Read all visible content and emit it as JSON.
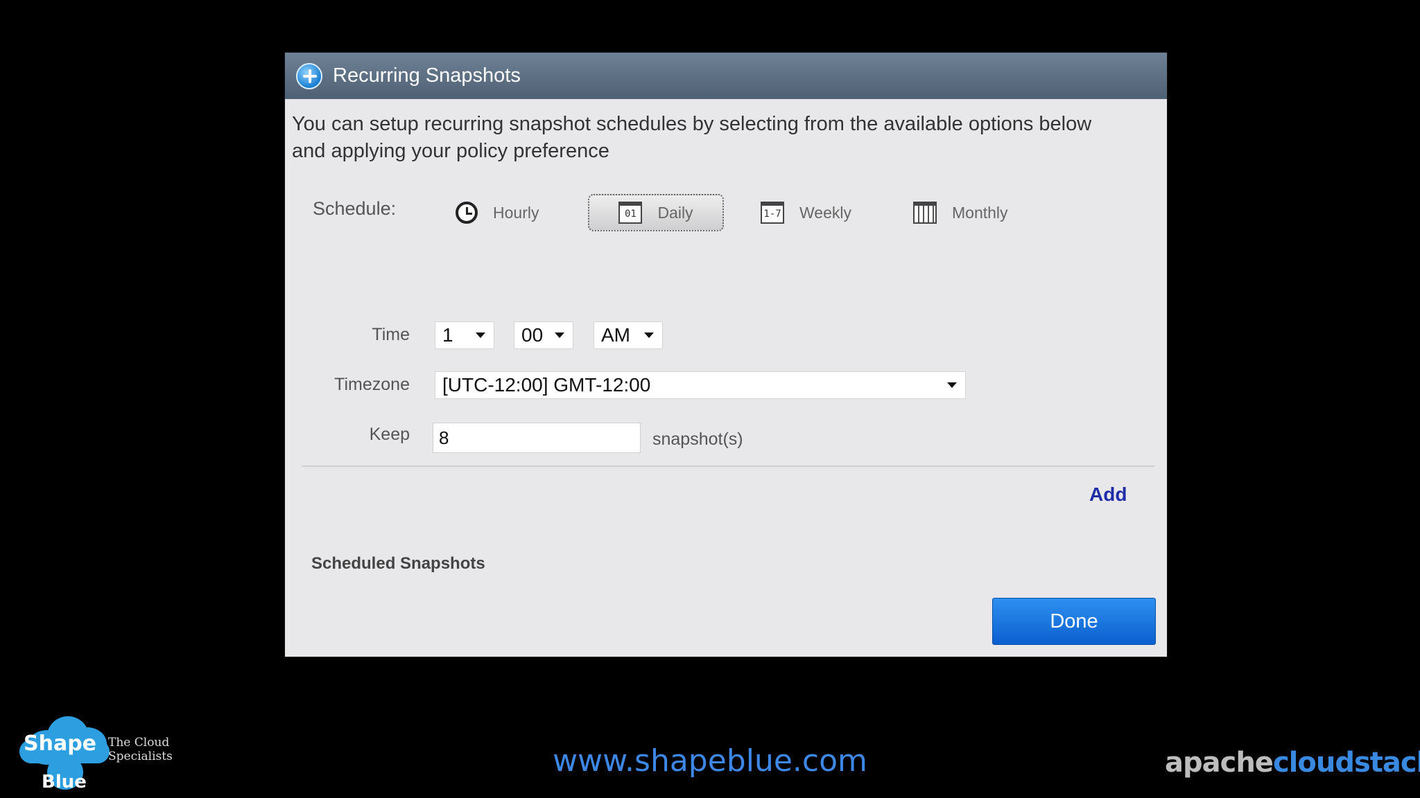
{
  "dialog": {
    "title": "Recurring Snapshots",
    "description": "You can setup recurring snapshot schedules by selecting from the available options below and applying your policy preference",
    "schedule": {
      "label": "Schedule:",
      "options": [
        {
          "label": "Hourly",
          "icon": "clock-icon"
        },
        {
          "label": "Daily",
          "icon": "calendar-day-icon",
          "icon_text": "01",
          "selected": true
        },
        {
          "label": "Weekly",
          "icon": "calendar-week-icon",
          "icon_text": "1-7"
        },
        {
          "label": "Monthly",
          "icon": "calendar-month-icon"
        }
      ]
    },
    "time": {
      "label": "Time",
      "hour": "1",
      "minute": "00",
      "meridiem": "AM"
    },
    "timezone": {
      "label": "Timezone",
      "value": "[UTC-12:00] GMT-12:00"
    },
    "keep": {
      "label": "Keep",
      "value": "8",
      "suffix": "snapshot(s)"
    },
    "add_label": "Add",
    "scheduled_heading": "Scheduled Snapshots",
    "done_label": "Done"
  },
  "footer": {
    "logo_shape": "Shape",
    "logo_blue": "Blue",
    "logo_tagline": "The Cloud Specialists",
    "website": "www.shapeblue.com",
    "brand_part1": "apache",
    "brand_part2": "cloudstack",
    "brand_tm": "™"
  },
  "colors": {
    "titlebar": "#55687b",
    "dialog_bg": "#e8e8ea",
    "accent_blue": "#0f6ad8",
    "link": "#1f2ca8"
  }
}
